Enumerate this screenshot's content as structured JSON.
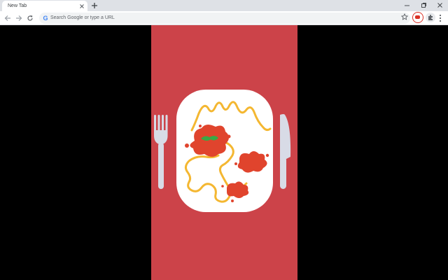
{
  "tab": {
    "title": "New Tab",
    "close_icon": "close-icon",
    "new_tab_icon": "plus-icon"
  },
  "window_controls": [
    "minimize-icon",
    "restore-icon",
    "close-icon"
  ],
  "toolbar": {
    "back_icon": "arrow-left-icon",
    "forward_icon": "arrow-right-icon",
    "reload_icon": "reload-icon",
    "omnibox_placeholder": "Search Google or type a URL",
    "bookmark_icon": "star-icon",
    "extension_icon": "tomato-extension-icon",
    "extensions_icon": "puzzle-icon",
    "menu_icon": "more-vert-icon"
  },
  "colors": {
    "tab_strip": "#dee1e6",
    "panel_background": "#cc4349",
    "plate": "#ffffff",
    "cutlery": "#d8dbe6",
    "spaghetti": "#f4b731",
    "sauce": "#e0442d",
    "basil": "#3aa845",
    "page_background": "#000000"
  }
}
